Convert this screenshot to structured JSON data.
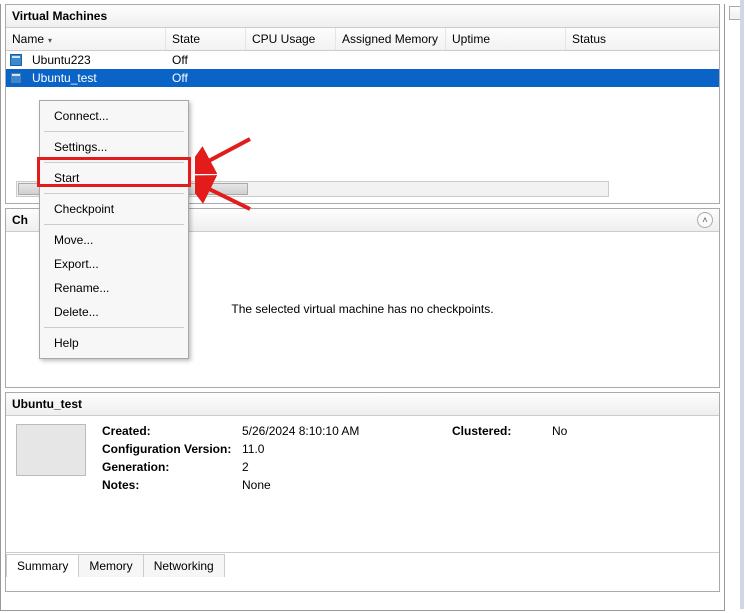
{
  "vmPanel": {
    "title": "Virtual Machines",
    "columns": {
      "name": "Name",
      "state": "State",
      "cpu": "CPU Usage",
      "mem": "Assigned Memory",
      "uptime": "Uptime",
      "status": "Status"
    },
    "rows": [
      {
        "name": "Ubuntu223",
        "state": "Off"
      },
      {
        "name": "Ubuntu_test",
        "state": "Off"
      }
    ]
  },
  "contextMenu": {
    "connect": "Connect...",
    "settings": "Settings...",
    "start": "Start",
    "checkpoint": "Checkpoint",
    "move": "Move...",
    "export": "Export...",
    "rename": "Rename...",
    "delete": "Delete...",
    "help": "Help"
  },
  "checkpoints": {
    "titleStub": "Ch",
    "empty": "The selected virtual machine has no checkpoints."
  },
  "details": {
    "title": "Ubuntu_test",
    "props": {
      "created_label": "Created:",
      "created_value": "5/26/2024 8:10:10 AM",
      "clustered_label": "Clustered:",
      "clustered_value": "No",
      "config_label": "Configuration Version:",
      "config_value": "11.0",
      "gen_label": "Generation:",
      "gen_value": "2",
      "notes_label": "Notes:",
      "notes_value": "None"
    },
    "tabs": {
      "summary": "Summary",
      "memory": "Memory",
      "networking": "Networking"
    }
  }
}
